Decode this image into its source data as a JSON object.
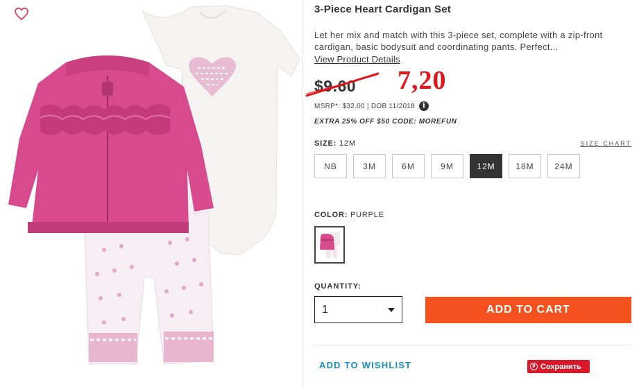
{
  "product": {
    "title": "3-Piece Heart Cardigan Set",
    "description": "Let her mix and match with this 3-piece set, complete with a zip-front cardigan, basic bodysuit and coordinating pants. Perfect...",
    "view_details_label": "View Product Details",
    "old_price": "$9.60",
    "new_price": "7,20",
    "msrp_text": "MSRP*: $32.00 | DOB 11/2018",
    "info_icon": "i",
    "promo": "EXTRA 25% OFF $50 CODE: MOREFUN"
  },
  "size": {
    "label": "SIZE:",
    "selected": "12M",
    "chart_label": "SIZE CHART",
    "options": [
      "NB",
      "3M",
      "6M",
      "9M",
      "12M",
      "18M",
      "24M"
    ]
  },
  "color": {
    "label": "COLOR:",
    "selected": "PURPLE"
  },
  "quantity": {
    "label": "QUANTITY:",
    "value": "1"
  },
  "actions": {
    "add_to_cart": "ADD TO CART",
    "add_to_wishlist": "ADD TO WISHLIST",
    "pinterest_save": "Сохранить",
    "pinterest_icon": "p"
  },
  "colors": {
    "add_to_cart_bg": "#f4511e",
    "new_price": "#e0161b",
    "wishlist_link": "#1a8fc3",
    "heart_icon": "#e0455e",
    "pinterest": "#d9182a",
    "cardigan": "#d84a8e",
    "selected_size_bg": "#333333"
  }
}
